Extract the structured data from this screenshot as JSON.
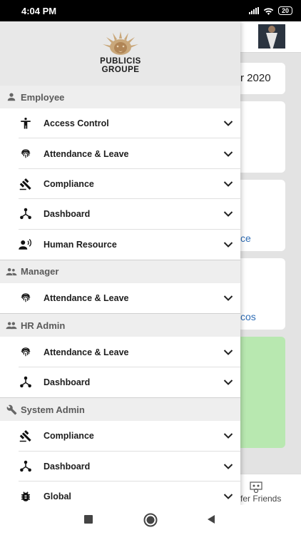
{
  "status_bar": {
    "time": "4:04 PM",
    "battery": "20"
  },
  "background": {
    "card1_text": "r 2020",
    "card3_link": "ce",
    "card4_link": "cos",
    "bottom_nav_label": "fer Friends"
  },
  "drawer": {
    "logo": {
      "line1": "PUBLICIS",
      "line2": "GROUPE"
    },
    "sections": [
      {
        "title": "Employee",
        "icon": "person-icon",
        "items": [
          {
            "label": "Access Control",
            "icon": "accessibility-icon"
          },
          {
            "label": "Attendance & Leave",
            "icon": "fingerprint-icon"
          },
          {
            "label": "Compliance",
            "icon": "gavel-icon"
          },
          {
            "label": "Dashboard",
            "icon": "device-hub-icon"
          },
          {
            "label": "Human Resource",
            "icon": "record-voice-icon"
          }
        ]
      },
      {
        "title": "Manager",
        "icon": "supervisor-icon",
        "items": [
          {
            "label": "Attendance & Leave",
            "icon": "fingerprint-icon"
          }
        ]
      },
      {
        "title": "HR Admin",
        "icon": "people-icon",
        "items": [
          {
            "label": "Attendance & Leave",
            "icon": "fingerprint-icon"
          },
          {
            "label": "Dashboard",
            "icon": "device-hub-icon"
          }
        ]
      },
      {
        "title": "System Admin",
        "icon": "wrench-icon",
        "items": [
          {
            "label": "Compliance",
            "icon": "gavel-icon"
          },
          {
            "label": "Dashboard",
            "icon": "device-hub-icon"
          },
          {
            "label": "Global",
            "icon": "bug-icon"
          }
        ]
      }
    ]
  }
}
